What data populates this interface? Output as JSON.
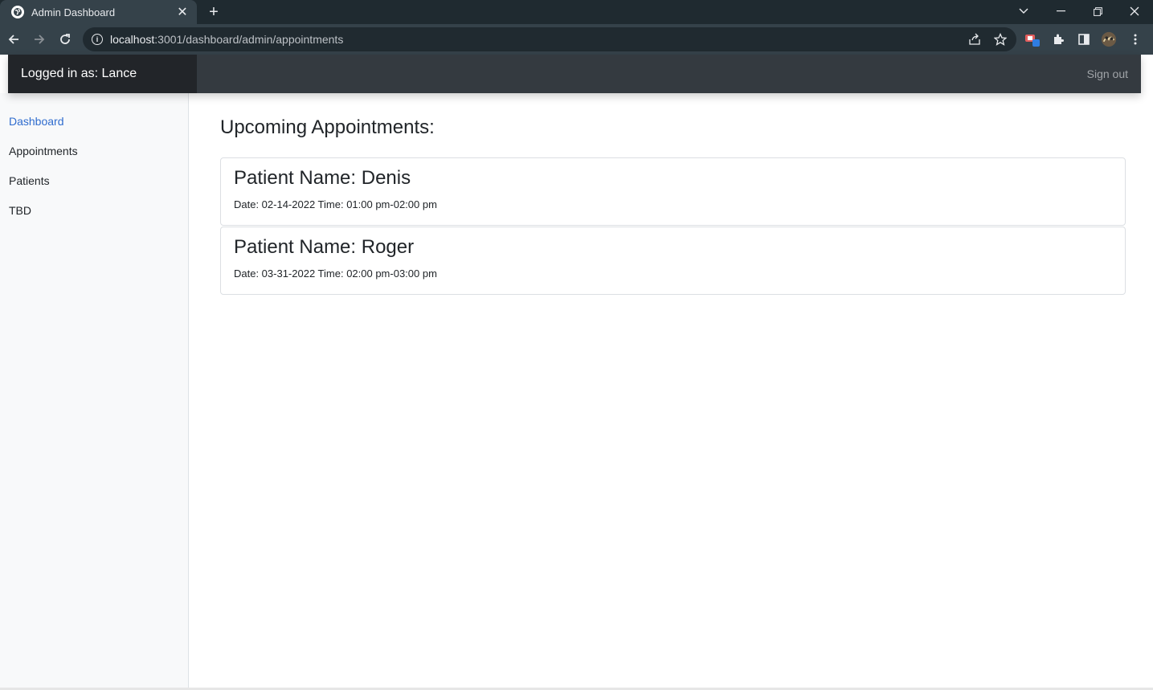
{
  "browser": {
    "tab_title": "Admin Dashboard",
    "url_host": "localhost",
    "url_rest": ":3001/dashboard/admin/appointments",
    "extension_badge": "1"
  },
  "header": {
    "logged_in_label": "Logged in as: Lance",
    "signout_label": "Sign out"
  },
  "sidebar": {
    "items": [
      {
        "label": "Dashboard",
        "active": true
      },
      {
        "label": "Appointments",
        "active": false
      },
      {
        "label": "Patients",
        "active": false
      },
      {
        "label": "TBD",
        "active": false
      }
    ]
  },
  "main": {
    "title": "Upcoming Appointments:",
    "appointments": [
      {
        "name": "Patient Name: Denis",
        "details": "Date: 02-14-2022 Time: 01:00 pm-02:00 pm"
      },
      {
        "name": "Patient Name: Roger",
        "details": "Date: 03-31-2022 Time: 02:00 pm-03:00 pm"
      }
    ]
  },
  "colors": {
    "header_bg": "#343a40",
    "brand_bg": "#222529",
    "active_link": "#2f6cce",
    "sidebar_bg": "#f8f9fa"
  }
}
